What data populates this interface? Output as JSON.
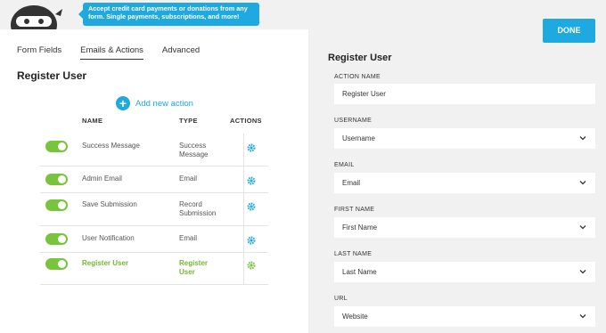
{
  "banner": {
    "promo_text": "Accept credit card payments or donations from any form. Single payments, subscriptions, and more!"
  },
  "tabs": [
    {
      "label": "Form Fields"
    },
    {
      "label": "Emails & Actions"
    },
    {
      "label": "Advanced"
    }
  ],
  "left": {
    "title": "Register User",
    "add_action_label": "Add new action",
    "columns": {
      "name": "NAME",
      "type": "TYPE",
      "actions": "ACTIONS"
    },
    "rows": [
      {
        "name": "Success Message",
        "type": "Success Message",
        "enabled": true
      },
      {
        "name": "Admin Email",
        "type": "Email",
        "enabled": true
      },
      {
        "name": "Save Submission",
        "type": "Record Submission",
        "enabled": true
      },
      {
        "name": "User Notification",
        "type": "Email",
        "enabled": true
      },
      {
        "name": "Register User",
        "type": "Register User",
        "enabled": true,
        "active": true
      }
    ]
  },
  "done_label": "DONE",
  "right": {
    "title": "Register User",
    "fields": [
      {
        "label": "ACTION NAME",
        "value": "Register User",
        "select": false
      },
      {
        "label": "USERNAME",
        "value": "Username",
        "select": true
      },
      {
        "label": "EMAIL",
        "value": "Email",
        "select": true
      },
      {
        "label": "FIRST NAME",
        "value": "First Name",
        "select": true
      },
      {
        "label": "LAST NAME",
        "value": "Last Name",
        "select": true
      },
      {
        "label": "URL",
        "value": "Website",
        "select": true
      }
    ]
  },
  "colors": {
    "accent": "#1ea9e1",
    "toggle_on": "#78c43c",
    "active_text": "#75b733"
  }
}
